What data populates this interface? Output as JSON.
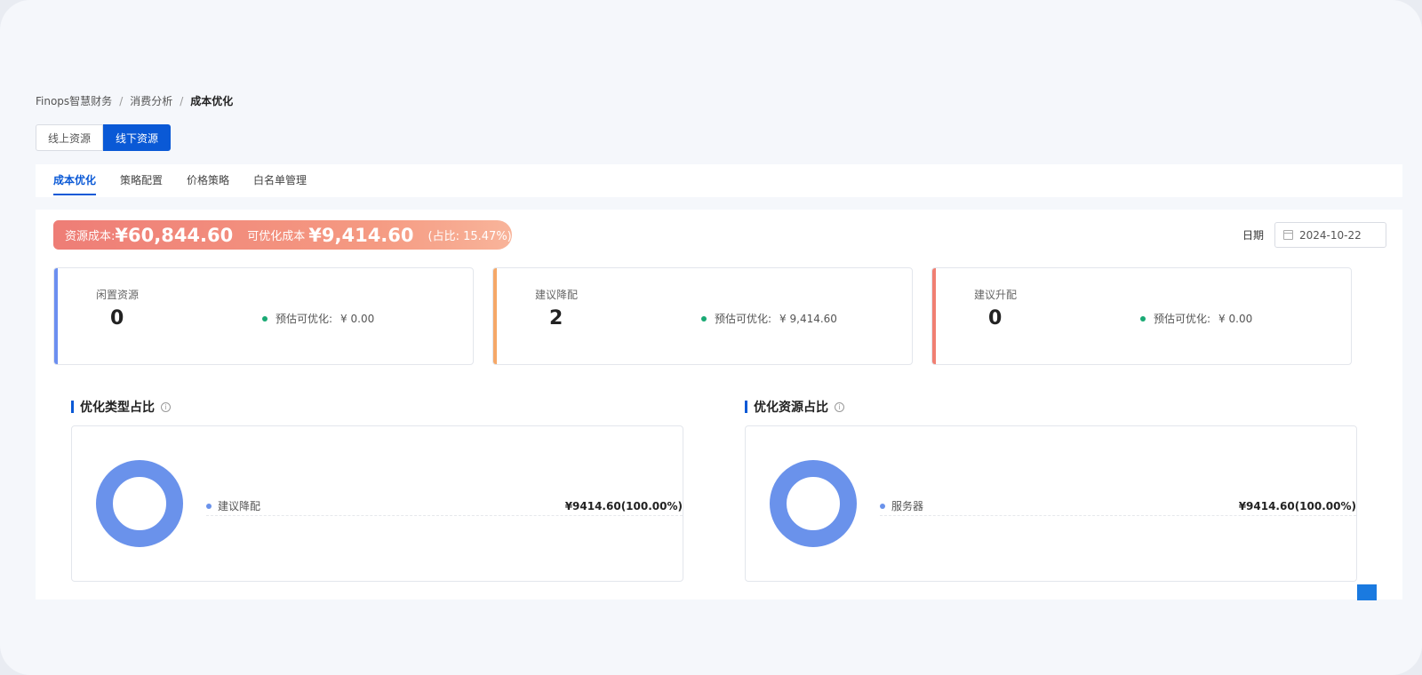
{
  "breadcrumb": [
    "Finops智慧财务",
    "消费分析",
    "成本优化"
  ],
  "segment": {
    "online": "线上资源",
    "offline": "线下资源",
    "active": "offline"
  },
  "tabs": [
    {
      "label": "成本优化",
      "active": true
    },
    {
      "label": "策略配置",
      "active": false
    },
    {
      "label": "价格策略",
      "active": false
    },
    {
      "label": "白名单管理",
      "active": false
    }
  ],
  "banner": {
    "resource_label": "资源成本:",
    "resource_value": "¥60,844.60",
    "optimizable_label": "可优化成本",
    "optimizable_value": "¥9,414.60",
    "ratio": "(占比: 15.47%)"
  },
  "date": {
    "label": "日期",
    "value": "2024-10-22"
  },
  "cards": [
    {
      "title": "闲置资源",
      "count": "0",
      "est_label": "预估可优化:",
      "est_value": "¥ 0.00",
      "color": "#6c8ff0"
    },
    {
      "title": "建议降配",
      "count": "2",
      "est_label": "预估可优化:",
      "est_value": "¥ 9,414.60",
      "color": "#f5a868"
    },
    {
      "title": "建议升配",
      "count": "0",
      "est_label": "预估可优化:",
      "est_value": "¥ 0.00",
      "color": "#f07f72"
    }
  ],
  "sections": [
    {
      "title": "优化类型占比",
      "legend": [
        {
          "name": "建议降配",
          "value": "¥9414.60(100.00%)",
          "color": "#6a92eb"
        }
      ]
    },
    {
      "title": "优化资源占比",
      "legend": [
        {
          "name": "服务器",
          "value": "¥9414.60(100.00%)",
          "color": "#6a92eb"
        }
      ]
    }
  ],
  "colors": {
    "accent": "#0a59d6",
    "donut": "#6a92eb",
    "dot_green": "#19a974"
  },
  "icons": {
    "calendar": "calendar-icon",
    "info": "info-icon"
  }
}
